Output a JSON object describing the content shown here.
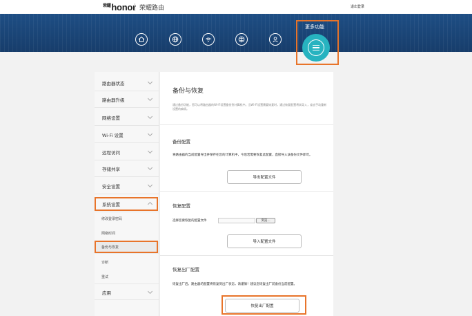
{
  "header": {
    "logo_prefix": "荣耀",
    "logo": "honor",
    "title": "荣耀路由",
    "logout": "退出登录"
  },
  "nav": {
    "icons": [
      "home-icon",
      "globe-icon",
      "wifi-icon",
      "network-globe-icon",
      "user-icon"
    ],
    "more_label": "更多功能",
    "more_icon": "menu-icon"
  },
  "sidebar": {
    "items": [
      {
        "label": "路由器状态"
      },
      {
        "label": "路由器升级"
      },
      {
        "label": "网络设置"
      },
      {
        "label": "Wi-Fi 设置"
      },
      {
        "label": "远程访问"
      },
      {
        "label": "存储共享"
      },
      {
        "label": "安全设置"
      },
      {
        "label": "系统设置"
      },
      {
        "label": "应用"
      }
    ],
    "sub_items": [
      {
        "label": "修改登录密码"
      },
      {
        "label": "网络时间"
      },
      {
        "label": "备份与恢复"
      },
      {
        "label": "诊断"
      },
      {
        "label": "重试"
      }
    ]
  },
  "main": {
    "title": "备份与恢复",
    "description": "通过备份功能，您可以将路由器的Wi-Fi设置备份到计算机中。当Wi-Fi设置需要恢复时，通过恢复配置将其导入，省去手动重新设置的麻烦。",
    "backup": {
      "title": "备份配置",
      "text": "将路由器的当前配置导出并保存在您的计算机中，今后若需要恢复此配置，直接导入该备份文件即可。",
      "button": "导出配置文件"
    },
    "restore": {
      "title": "恢复配置",
      "file_label": "选择您要恢复的配置文件",
      "browse": "浏览...",
      "button": "导入配置文件"
    },
    "factory": {
      "title": "恢复出厂配置",
      "text": "恢复出厂后，路由器的配置将恢复到出厂状态，请谨慎！建议您恢复出厂前备份当前配置。",
      "button": "恢复出厂配置"
    }
  },
  "colors": {
    "banner": "#1d4b80",
    "accent": "#27b3c0",
    "highlight": "#e8742a"
  }
}
